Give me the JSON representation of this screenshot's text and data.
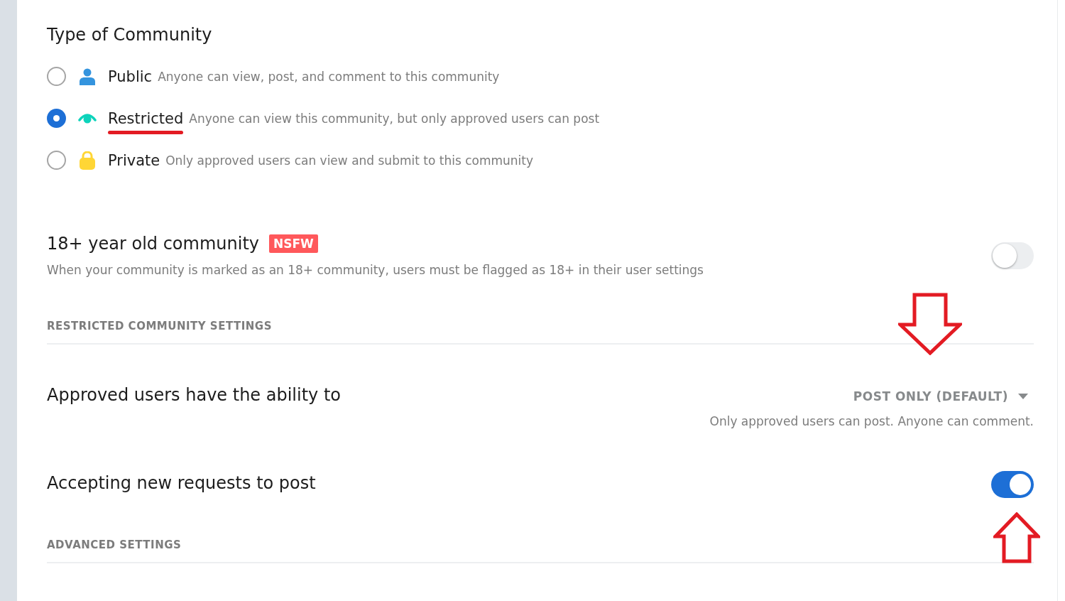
{
  "section_title": "Type of Community",
  "community_types": [
    {
      "kind": "public",
      "label": "Public",
      "description": "Anyone can view, post, and comment to this community",
      "selected": false,
      "underlined": false
    },
    {
      "kind": "restricted",
      "label": "Restricted",
      "description": "Anyone can view this community, but only approved users can post",
      "selected": true,
      "underlined": true
    },
    {
      "kind": "private",
      "label": "Private",
      "description": "Only approved users can view and submit to this community",
      "selected": false,
      "underlined": false
    }
  ],
  "nsfw_setting": {
    "title": "18+ year old community",
    "badge": "NSFW",
    "description": "When your community is marked as an 18+ community, users must be flagged as 18+ in their user settings",
    "on": false
  },
  "restricted_settings": {
    "heading": "RESTRICTED COMMUNITY SETTINGS",
    "arrow_marked": true,
    "approved_users": {
      "title": "Approved users have the ability to",
      "value": "POST ONLY (DEFAULT)",
      "description": "Only approved users can post. Anyone can comment."
    },
    "accepting_requests": {
      "title": "Accepting new requests to post",
      "on": true,
      "arrow_marked": true
    }
  },
  "advanced_settings": {
    "heading": "ADVANCED SETTINGS"
  }
}
